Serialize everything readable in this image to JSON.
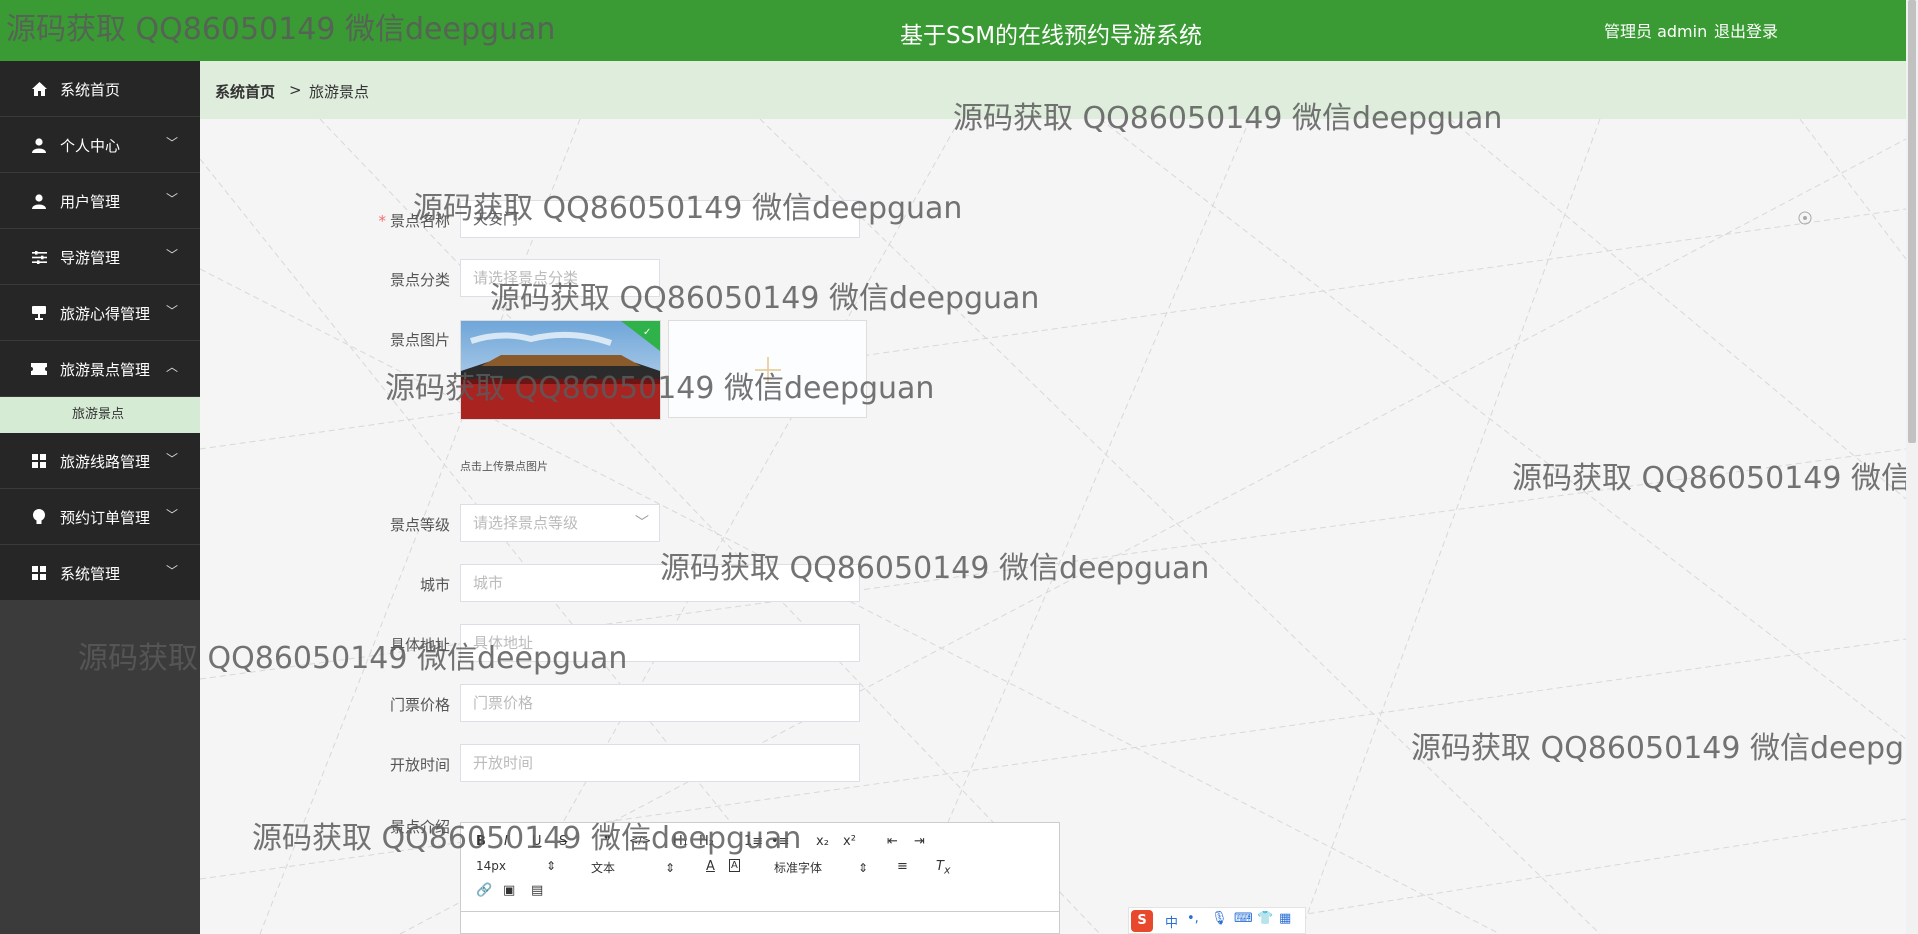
{
  "header": {
    "title": "基于SSM的在线预约导游系统",
    "user": "管理员 admin",
    "logout": "退出登录"
  },
  "sidebar": {
    "items": [
      {
        "label": "系统首页",
        "icon": "home-icon"
      },
      {
        "label": "个人中心",
        "icon": "person-icon"
      },
      {
        "label": "用户管理",
        "icon": "user-icon"
      },
      {
        "label": "导游管理",
        "icon": "sliders-icon"
      },
      {
        "label": "旅游心得管理",
        "icon": "board-icon"
      },
      {
        "label": "旅游景点管理",
        "icon": "ticket-icon"
      },
      {
        "label": "旅游线路管理",
        "icon": "grid-icon"
      },
      {
        "label": "预约订单管理",
        "icon": "bulb-icon"
      },
      {
        "label": "系统管理",
        "icon": "grid-icon"
      }
    ],
    "sub_item": "旅游景点"
  },
  "breadcrumb": {
    "home": "系统首页",
    "separator": ">",
    "current": "旅游景点"
  },
  "form": {
    "name_label": "景点名称",
    "name_value": "天安门",
    "category_label": "景点分类",
    "category_placeholder": "请选择景点分类",
    "image_label": "景点图片",
    "upload_tip": "点击上传景点图片",
    "level_label": "景点等级",
    "level_placeholder": "请选择景点等级",
    "city_label": "城市",
    "city_placeholder": "城市",
    "address_label": "具体地址",
    "address_placeholder": "具体地址",
    "price_label": "门票价格",
    "price_placeholder": "门票价格",
    "hours_label": "开放时间",
    "hours_placeholder": "开放时间",
    "intro_label": "景点介绍"
  },
  "editor": {
    "row1": [
      "B",
      "I",
      "U",
      "S",
      "❞",
      "</>",
      "H₁",
      "H₂",
      "1≡",
      "•≡",
      "x₂",
      "x²",
      "⇤",
      "⇥"
    ],
    "font_size": "14px",
    "text_style": "文本",
    "font_family": "标准字体"
  },
  "ime": {
    "mode": "中"
  },
  "watermark": "源码获取 QQ86050149 微信deepguan",
  "colors": {
    "header_green": "#3a9b34",
    "sidebar_dark": "#262626",
    "breadcrumb_bg": "#dfeddc",
    "active_sub_bg": "#d6ebd4"
  }
}
